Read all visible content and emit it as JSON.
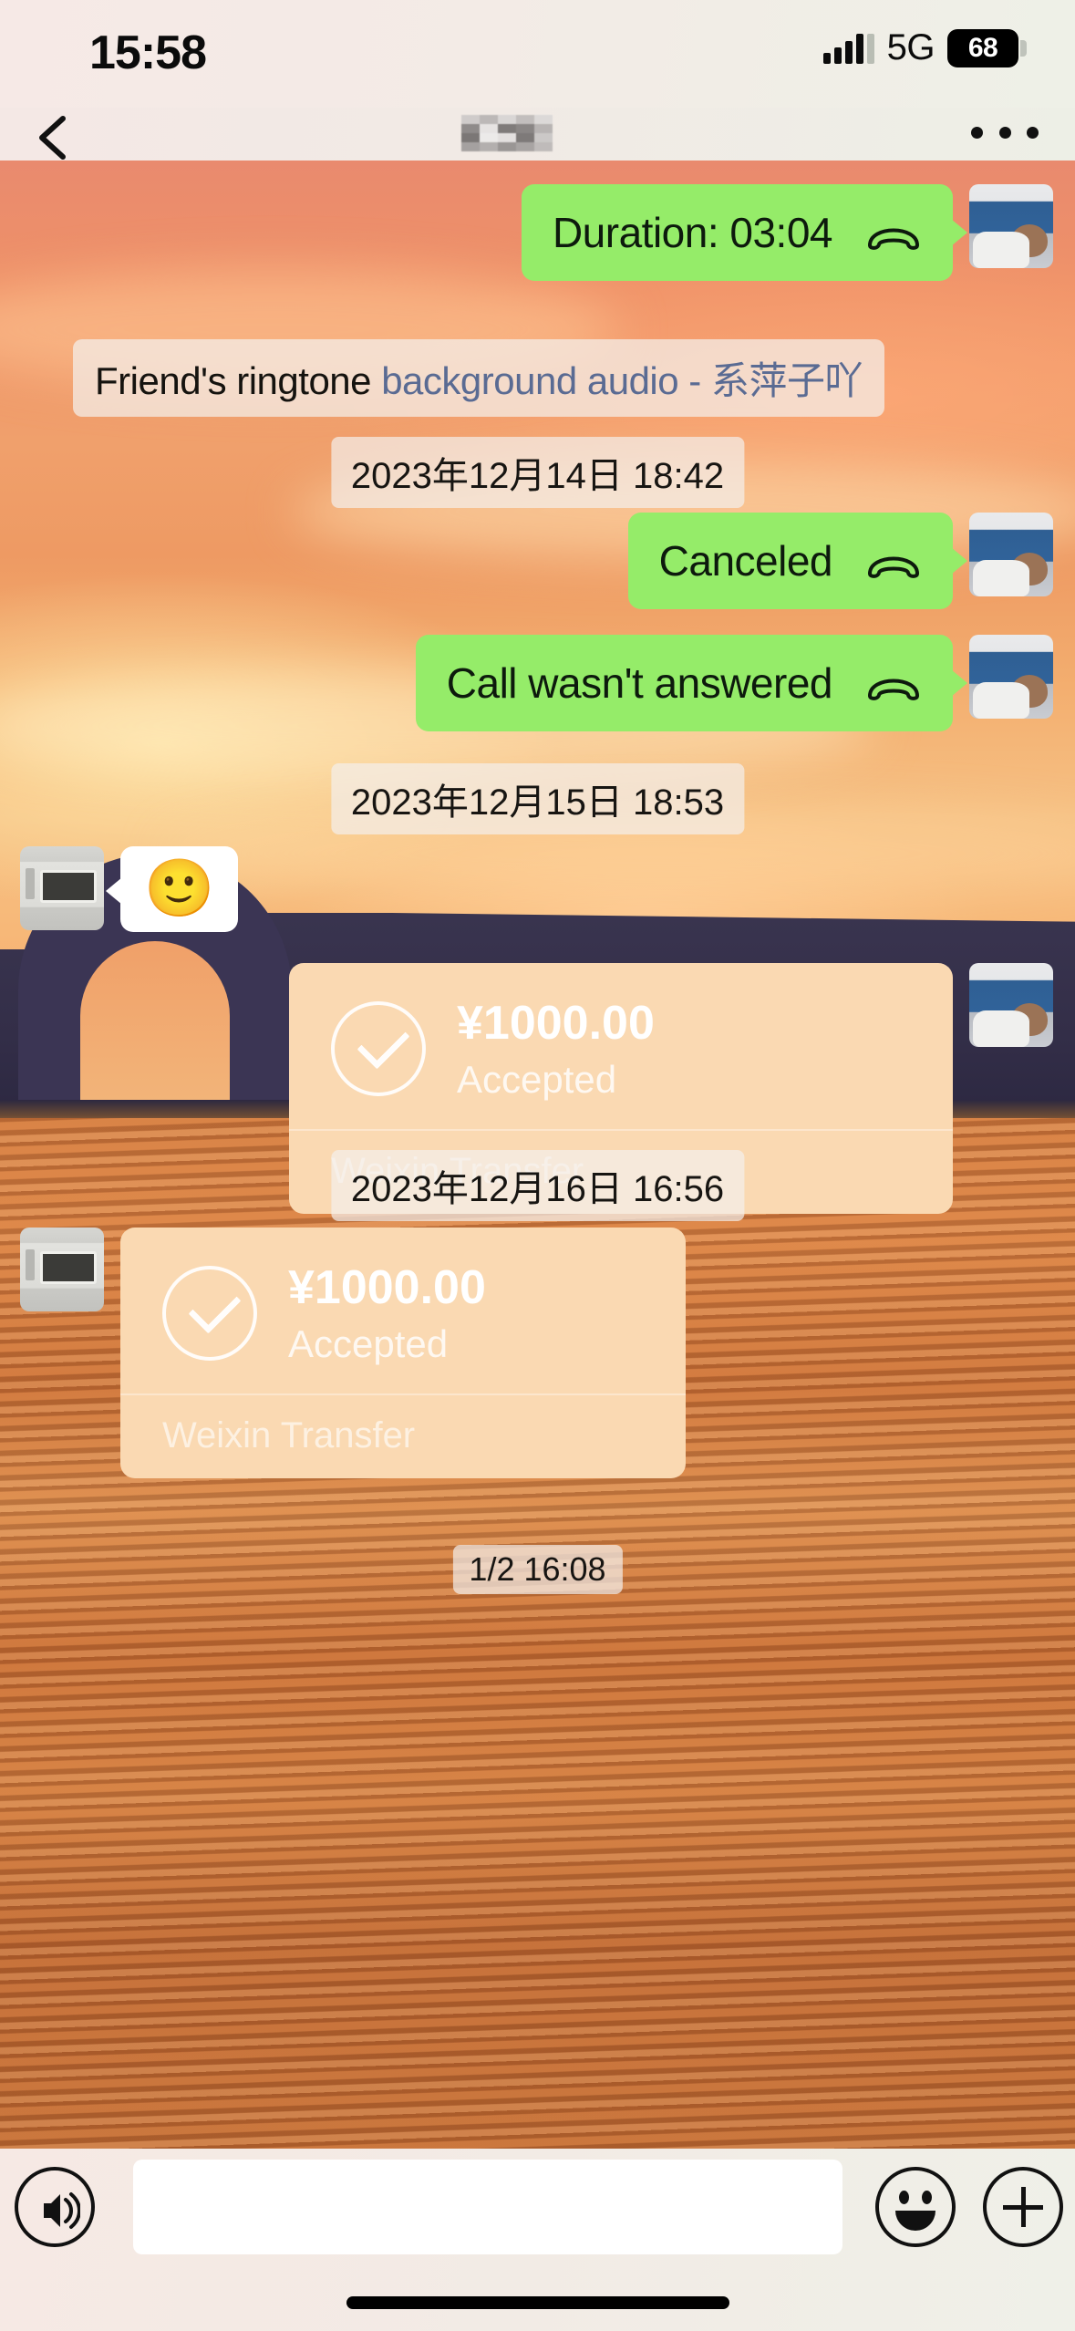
{
  "status_bar": {
    "time": "15:58",
    "network": "5G",
    "battery_level": "68",
    "signal_icon": "signal-bars-icon",
    "battery_icon": "battery-icon"
  },
  "nav_bar": {
    "back_icon": "chevron-left-icon",
    "title": "",
    "title_state": "blurred-mosaic",
    "more_icon": "more-horizontal-icon"
  },
  "theme": {
    "outgoing_bubble": "#95ec69",
    "incoming_bubble": "#ffffff",
    "transfer_card": "#fad9b2",
    "pill_background": "rgba(244,240,236,0.72)",
    "link_text": "#5a6b93"
  },
  "messages": [
    {
      "id": "call-duration",
      "side": "outgoing",
      "type": "voice-call",
      "text": "Duration: 03:04",
      "icon": "phone-handset-icon",
      "avatar": "avatar-baby"
    },
    {
      "id": "ringtone-notice",
      "side": "system",
      "type": "system-notice",
      "prefix": "Friend's ringtone ",
      "link": "background audio - 系萍子吖"
    },
    {
      "id": "date-1",
      "side": "center",
      "type": "date-separator",
      "text": "2023年12月14日 18:42"
    },
    {
      "id": "call-canceled",
      "side": "outgoing",
      "type": "voice-call",
      "text": "Canceled",
      "icon": "phone-handset-icon",
      "avatar": "avatar-baby"
    },
    {
      "id": "call-unanswered",
      "side": "outgoing",
      "type": "voice-call",
      "text": "Call wasn't answered",
      "icon": "phone-handset-icon",
      "avatar": "avatar-baby"
    },
    {
      "id": "date-2",
      "side": "center",
      "type": "date-separator",
      "text": "2023年12月15日 18:53"
    },
    {
      "id": "emoji-msg",
      "side": "incoming",
      "type": "emoji",
      "text": "🙂",
      "avatar": "avatar-device"
    },
    {
      "id": "transfer-1",
      "side": "outgoing",
      "type": "transfer",
      "amount": "¥1000.00",
      "status": "Accepted",
      "footer": "Weixin Transfer",
      "icon": "check-circle-icon",
      "avatar": "avatar-baby"
    },
    {
      "id": "date-3",
      "side": "center",
      "type": "date-separator",
      "text": "2023年12月16日 16:56"
    },
    {
      "id": "transfer-2",
      "side": "incoming",
      "type": "transfer",
      "amount": "¥1000.00",
      "status": "Accepted",
      "footer": "Weixin Transfer",
      "icon": "check-circle-icon",
      "avatar": "avatar-device"
    },
    {
      "id": "time-last",
      "side": "center",
      "type": "time-separator",
      "text": "1/2 16:08"
    }
  ],
  "input_bar": {
    "voice_icon": "voice-wave-icon",
    "input_value": "",
    "input_placeholder": "",
    "emoji_icon": "smiley-face-icon",
    "plus_icon": "plus-circle-icon"
  }
}
